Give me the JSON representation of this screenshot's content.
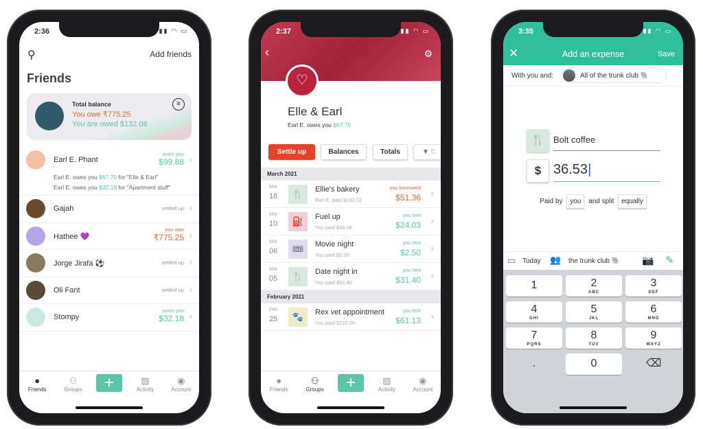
{
  "phone1": {
    "time": "2:36",
    "search_icon": "search-icon",
    "add_friends": "Add friends",
    "title": "Friends",
    "balance": {
      "label": "Total balance",
      "owe": "You owe ₹775.25",
      "owed": "You are owed $132.06"
    },
    "friends": [
      {
        "name": "Earl E. Phant",
        "status": "owes you",
        "amount": "$99.88",
        "tone": "green",
        "details": [
          {
            "pre": "Earl E. owes you ",
            "amt": "$67.70",
            "post": " for \"Elle & Earl\""
          },
          {
            "pre": "Earl E. owes you ",
            "amt": "$32.18",
            "post": " for \"Apartment stuff\""
          }
        ]
      },
      {
        "name": "Gajah",
        "status": "settled up",
        "amount": "",
        "tone": "gray"
      },
      {
        "name": "Hathee 💜",
        "status": "you owe",
        "amount": "₹775.25",
        "tone": "orange"
      },
      {
        "name": "Jorge Jirafa ⚽",
        "status": "settled up",
        "amount": "",
        "tone": "gray"
      },
      {
        "name": "Oli Fant",
        "status": "settled up",
        "amount": "",
        "tone": "gray"
      },
      {
        "name": "Stompy",
        "status": "owes you",
        "amount": "$32.18",
        "tone": "green"
      }
    ],
    "tabs": [
      "Friends",
      "Groups",
      "",
      "Activity",
      "Account"
    ]
  },
  "phone2": {
    "time": "2:37",
    "group_name": "Elle & Earl",
    "summary_pre": "Earl E. owes you ",
    "summary_amt": "$67.70",
    "buttons": [
      "Settle up",
      "Balances",
      "Totals",
      "C"
    ],
    "sections": [
      {
        "title": "March 2021",
        "items": [
          {
            "month": "Mar",
            "day": "18",
            "icon": "fork-knife-icon",
            "glyph": "🍴",
            "bg": "#d8eadf",
            "name": "Ellie's bakery",
            "paid": "Earl E. paid $102.72",
            "status": "you borrowed",
            "amount": "$51.36",
            "tone": "orange"
          },
          {
            "month": "Mar",
            "day": "10",
            "icon": "fuel-pump-icon",
            "glyph": "⛽",
            "bg": "#f0d0d6",
            "name": "Fuel up",
            "paid": "You paid $48.06",
            "status": "you lent",
            "amount": "$24.03",
            "tone": "green"
          },
          {
            "month": "Mar",
            "day": "06",
            "icon": "tickets-icon",
            "glyph": "🎟",
            "bg": "#e2dcf0",
            "name": "Movie night",
            "paid": "You paid $5.00",
            "status": "you lent",
            "amount": "$2.50",
            "tone": "green"
          },
          {
            "month": "Mar",
            "day": "05",
            "icon": "fork-knife-icon",
            "glyph": "🍴",
            "bg": "#d8eadf",
            "name": "Date night in",
            "paid": "You paid $62.80",
            "status": "you lent",
            "amount": "$31.40",
            "tone": "green"
          }
        ]
      },
      {
        "title": "February 2021",
        "items": [
          {
            "month": "Feb",
            "day": "25",
            "icon": "paw-icon",
            "glyph": "🐾",
            "bg": "#f0eccb",
            "name": "Rex vet appointment",
            "paid": "You paid $122.26",
            "status": "you lent",
            "amount": "$61.13",
            "tone": "green"
          }
        ]
      }
    ],
    "tabs": [
      "Friends",
      "Groups",
      "",
      "Activity",
      "Account"
    ]
  },
  "phone3": {
    "time": "3:35",
    "title": "Add an expense",
    "save": "Save",
    "with_label": "With you and:",
    "with_group": "All of the trunk club 🐘",
    "description": "Bolt coffee",
    "currency": "$",
    "amount": "36.53",
    "paid_by": "Paid by",
    "payer": "you",
    "and_split": "and split",
    "split": "equally",
    "date": "Today",
    "group": "the trunk club 🐘",
    "keys": [
      [
        "1",
        ""
      ],
      [
        "2",
        "ABC"
      ],
      [
        "3",
        "DEF"
      ],
      [
        "4",
        "GHI"
      ],
      [
        "5",
        "JKL"
      ],
      [
        "6",
        "MNO"
      ],
      [
        "7",
        "PQRS"
      ],
      [
        "8",
        "TUV"
      ],
      [
        "9",
        "WXYZ"
      ],
      [
        ".",
        ""
      ],
      [
        "0",
        ""
      ],
      [
        "⌫",
        ""
      ]
    ]
  },
  "colors": {
    "accent": "#5bc5a7",
    "owe": "#e0693a",
    "settle": "#e4432a",
    "group_header": "#b3283f"
  }
}
